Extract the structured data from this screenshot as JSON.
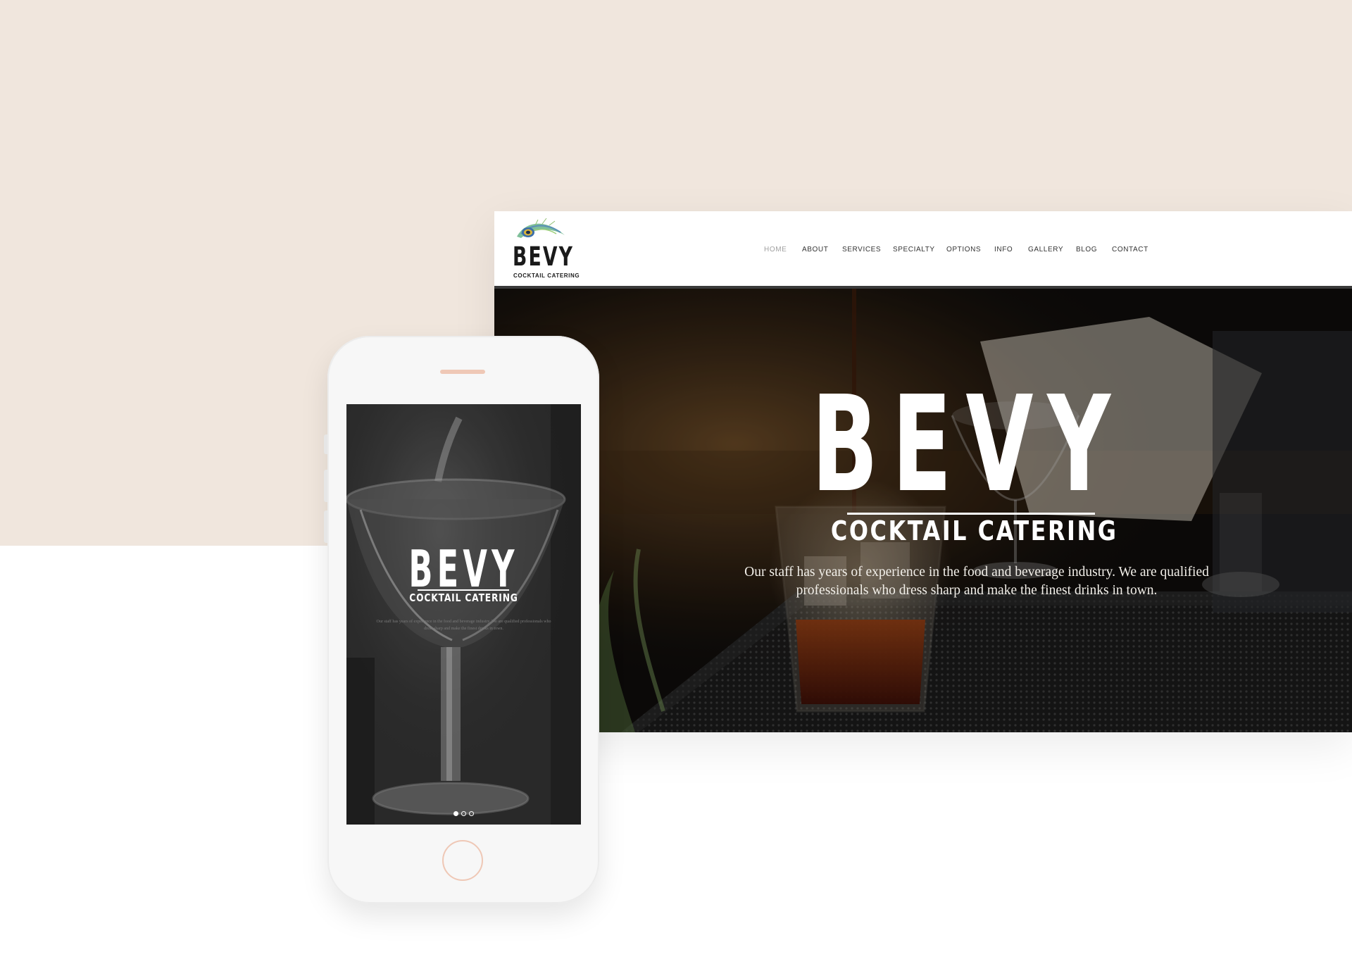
{
  "colors": {
    "background_band": "#f0e6dd",
    "page_background": "#ffffff",
    "phone_accent": "#efc8b6",
    "nav_text": "#333333",
    "nav_active": "#a0a0a0"
  },
  "desktop": {
    "logo": {
      "word": "BEVY",
      "sub": "COCKTAIL CATERING",
      "icon": "peacock-feather-icon"
    },
    "nav": [
      {
        "label": "HOME",
        "active": true
      },
      {
        "label": "ABOUT",
        "active": false
      },
      {
        "label": "SERVICES",
        "active": false
      },
      {
        "label": "SPECIALTY",
        "active": false
      },
      {
        "label": "OPTIONS",
        "active": false
      },
      {
        "label": "INFO",
        "active": false
      },
      {
        "label": "GALLERY",
        "active": false
      },
      {
        "label": "BLOG",
        "active": false
      },
      {
        "label": "CONTACT",
        "active": false
      }
    ],
    "hero": {
      "title": "BEVY",
      "subtitle": "COCKTAIL CATERING",
      "description": "Our staff has years of experience in the food and beverage industry. We are qualified professionals who dress sharp and make the finest drinks in town."
    }
  },
  "mobile": {
    "title": "BEVY",
    "subtitle": "COCKTAIL CATERING",
    "description": "Our staff has years of experience in the food and beverage industry. We are qualified professionals who dress sharp and make the finest drinks in town.",
    "slides": {
      "count": 3,
      "active": 1
    }
  }
}
